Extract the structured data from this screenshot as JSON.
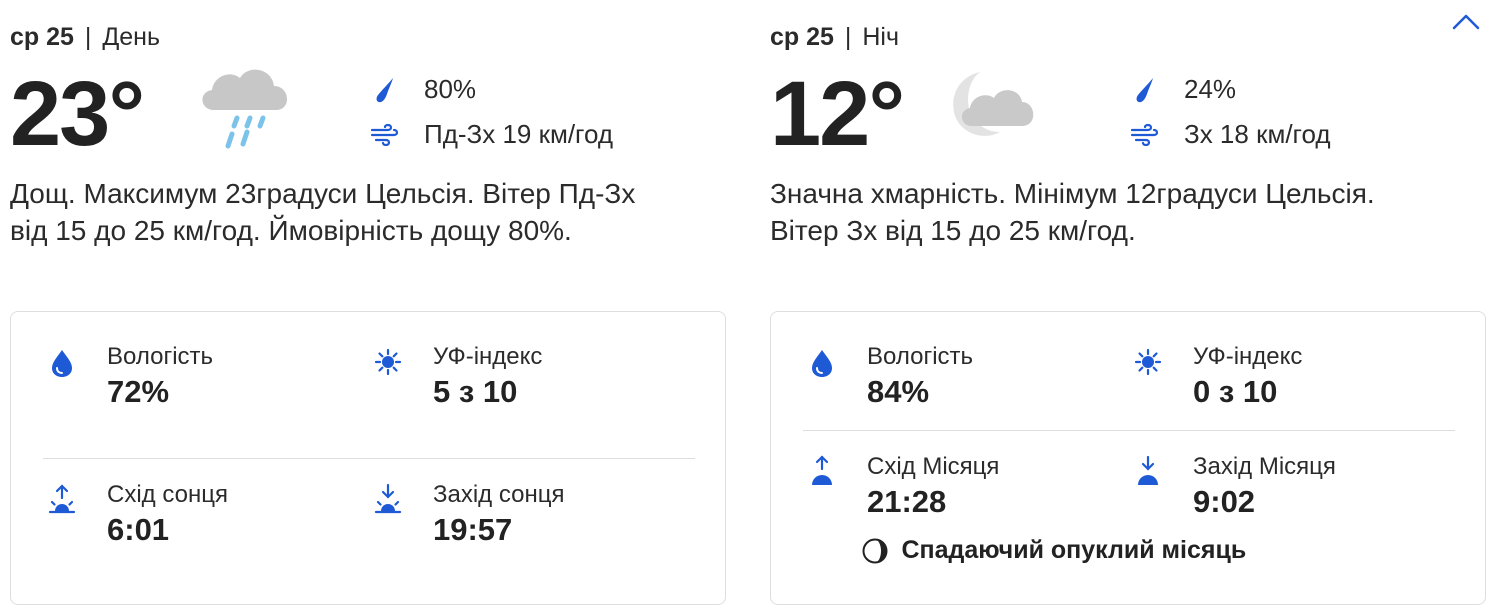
{
  "colors": {
    "accent": "#1f5ad6",
    "text": "#2b2b2b",
    "border": "#dedede"
  },
  "collapse": {
    "icon": "chevron-up-icon"
  },
  "day": {
    "date": "ср 25",
    "separator": "|",
    "period": "День",
    "temperature": "23°",
    "weather_icon": "rain-cloud-icon",
    "precip": "80%",
    "wind": "Пд-Зх 19 км/год",
    "description": "Дощ. Максимум 23градуси Цельсія. Вітер Пд-Зх від 15 до 25 км/год. Ймовірність дощу 80%.",
    "humidity": {
      "label": "Вологість",
      "value": "72%"
    },
    "uv": {
      "label": "УФ-індекс",
      "value": "5 з 10"
    },
    "rise": {
      "label": "Схід сонця",
      "value": "6:01"
    },
    "set": {
      "label": "Захід сонця",
      "value": "19:57"
    }
  },
  "night": {
    "date": "ср 25",
    "separator": "|",
    "period": "Ніч",
    "temperature": "12°",
    "weather_icon": "cloudy-night-icon",
    "precip": "24%",
    "wind": "Зх 18 км/год",
    "description": "Значна хмарність. Мінімум 12градуси Цельсія. Вітер Зх від 15 до 25 км/год.",
    "humidity": {
      "label": "Вологість",
      "value": "84%"
    },
    "uv": {
      "label": "УФ-індекс",
      "value": "0 з 10"
    },
    "rise": {
      "label": "Схід Місяця",
      "value": "21:28"
    },
    "set": {
      "label": "Захід Місяця",
      "value": "9:02"
    },
    "moon_phase": "Спадаючий опуклий місяць"
  }
}
